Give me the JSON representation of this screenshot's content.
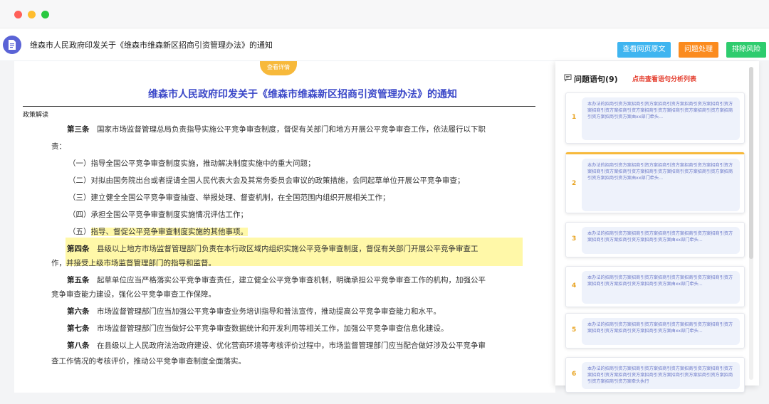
{
  "header": {
    "title": "维森市人民政府印发关于《维森市维森新区招商引资管理办法》的通知",
    "buttons": {
      "view_original": "查看网页原文",
      "issue_handling": "问题处理",
      "risk_clear": "排除风险"
    }
  },
  "document": {
    "view_tab": "查看详情",
    "title": "维森市人民政府印发关于《维森市维森新区招商引资管理办法》的通知",
    "section_label": "政策解读",
    "lines": [
      {
        "bold": "第三条",
        "text": "　国家市场监督管理总局负责指导实施公平竞争审查制度，督促有关部门和地方开展公平竞争审查工作，依法履行以下职"
      },
      {
        "bold": "",
        "text": "责："
      },
      {
        "bold": "",
        "text": "（一）指导全国公平竞争审查制度实施，推动解决制度实施中的重大问题；"
      },
      {
        "bold": "",
        "text": "（二）对拟由国务院出台或者提请全国人民代表大会及其常务委员会审议的政策措施，会同起草单位开展公平竞争审查；"
      },
      {
        "bold": "",
        "text": "（三）建立健全全国公平竞争审查抽查、举报处理、督查机制，在全国范围内组织开展相关工作；"
      },
      {
        "bold": "",
        "text": "（四）承担全国公平竞争审查制度实施情况评估工作；"
      },
      {
        "bold": "",
        "prefix": "（五）",
        "highlight": "指导、督促公平竞争审查制度实施的其他事项。"
      },
      {
        "bold": "第四条",
        "text": "　县级以上地方市场监督管理部门负责在本行政区域内组织实施公平竞争审查制度，督促有关部门开展公平竞争审查工"
      },
      {
        "bold": "",
        "text": "作，并接受上级市场监督管理部门的指导和监督。"
      },
      {
        "bold": "第五条",
        "text": "　起草单位应当严格落实公平竞争审查责任，建立健全公平竞争审查机制，明确承担公平竞争审查工作的机构，加强公平"
      },
      {
        "bold": "",
        "text": "竞争审查能力建设，强化公平竞争审查工作保障。"
      },
      {
        "bold": "第六条",
        "text": "　市场监督管理部门应当加强公平竞争审查业务培训指导和普法宣传，推动提高公平竞争审查能力和水平。"
      },
      {
        "bold": "第七条",
        "text": "　市场监督管理部门应当做好公平竞争审查数据统计和开发利用等相关工作，加强公平竞争审查信息化建设。"
      },
      {
        "bold": "第八条",
        "text": "　在县级以上人民政府法治政府建设、优化营商环境等考核评价过程中，市场监督管理部门应当配合做好涉及公平竞争审"
      },
      {
        "bold": "",
        "text": "查工作情况的考核评价，推动公平竞争审查制度全面落实。"
      }
    ]
  },
  "panel": {
    "title": "问题语句(9)",
    "link": "点击查看语句分析列表",
    "cards": [
      {
        "num": "1",
        "text": "本办法的招商引资方案招商引资方案招商引资方案招商引资方案招商引资方案招商引资方案招商引资方案招商引资方案招商引资方案招商引资方案招商引资方案招商引资方案由xx部门牵头..."
      },
      {
        "num": "2",
        "text": "本办法的招商引资方案招商引资方案招商引资方案招商引资方案招商引资方案招商引资方案招商引资方案招商引资方案招商引资方案招商引资方案招商引资方案招商引资方案由xx部门牵头..."
      },
      {
        "num": "3",
        "text": "本办法的招商引资方案招商引资方案招商引资方案招商引资方案招商引资方案招商引资方案招商引资方案招商引资方案由xx部门牵头..."
      },
      {
        "num": "4",
        "text": "本办法的招商引资方案招商引资方案招商引资方案招商引资方案招商引资方案招商引资方案招商引资方案招商引资方案由xx部门牵头..."
      },
      {
        "num": "5",
        "text": "本办法的招商引资方案招商引资方案招商引资方案招商引资方案招商引资方案招商引资方案招商引资方案招商引资方案由xx部门牵头..."
      },
      {
        "num": "6",
        "text": "本办法的招商引资方案招商引资方案招商引资方案招商引资方案招商引资方案招商引资方案招商引资方案招商引资方案招商引资方案招商引资方案招商引资方案招商引资方案牵头执行"
      }
    ]
  }
}
